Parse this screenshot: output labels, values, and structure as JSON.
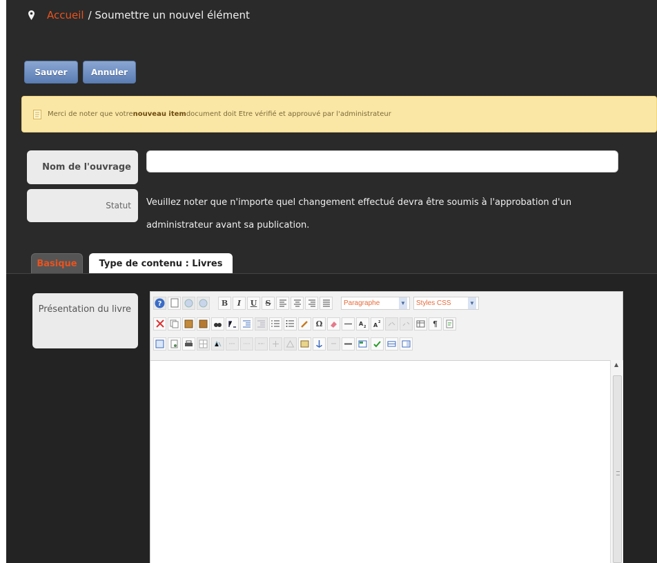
{
  "breadcrumb": {
    "home": "Accueil",
    "current": "/ Soumettre un nouvel élément"
  },
  "buttons": {
    "save": "Sauver",
    "cancel": "Annuler"
  },
  "notice": {
    "prefix": "Merci de noter que votre ",
    "bold": "nouveau item",
    "suffix": " document doit Etre vérifié et approuvé par l'administrateur"
  },
  "form": {
    "name_label": "Nom de l'ouvrage",
    "name_value": "",
    "status_label": "Statut",
    "status_text": "Veuillez noter que n'importe quel changement effectué devra être soumis à l'approbation d'un administrateur avant sa publication."
  },
  "tabs": [
    {
      "label": "Basique",
      "active": false
    },
    {
      "label": "Type de contenu : Livres",
      "active": true
    }
  ],
  "editor": {
    "label": "Présentation du livre",
    "format_select": "Paragraphe",
    "style_select": "Styles CSS",
    "bold": "B",
    "italic": "I",
    "underline": "U",
    "strike": "S",
    "omega": "Ω",
    "pilcrow": "¶",
    "content": ""
  },
  "colors": {
    "accent": "#e8531f",
    "background": "#2a2a2a",
    "button": "#6f8fc4",
    "notice_bg": "#fbe7a5"
  }
}
